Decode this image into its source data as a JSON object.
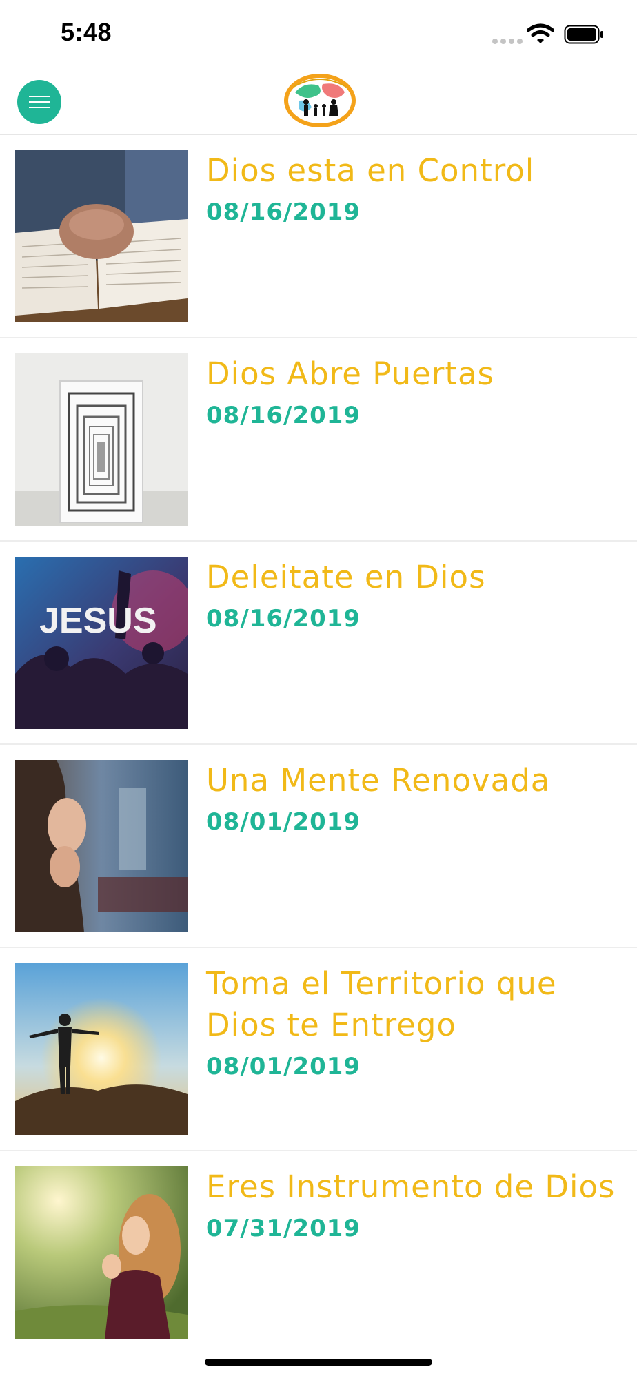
{
  "status_bar": {
    "time": "5:48"
  },
  "header": {
    "menu_icon": "hamburger-menu-icon",
    "logo": "church-family-globe-logo"
  },
  "posts": [
    {
      "title": "Dios esta en Control",
      "date": "08/16/2019",
      "image": "hands-praying-on-bible"
    },
    {
      "title": "Dios Abre Puertas",
      "date": "08/16/2019",
      "image": "endless-doorways"
    },
    {
      "title": "Deleitate en Dios",
      "date": "08/16/2019",
      "image": "jesus-worship-crowd"
    },
    {
      "title": "Una Mente Renovada",
      "date": "08/01/2019",
      "image": "woman-praying"
    },
    {
      "title": "Toma el Territorio que Dios te Entrego",
      "date": "08/01/2019",
      "image": "man-arms-wide-sunrise"
    },
    {
      "title": "Eres Instrumento de Dios",
      "date": "07/31/2019",
      "image": "woman-praying-outdoors"
    }
  ],
  "colors": {
    "accent_teal": "#1fb596",
    "title_gold": "#f1b918",
    "divider": "#ededed"
  }
}
